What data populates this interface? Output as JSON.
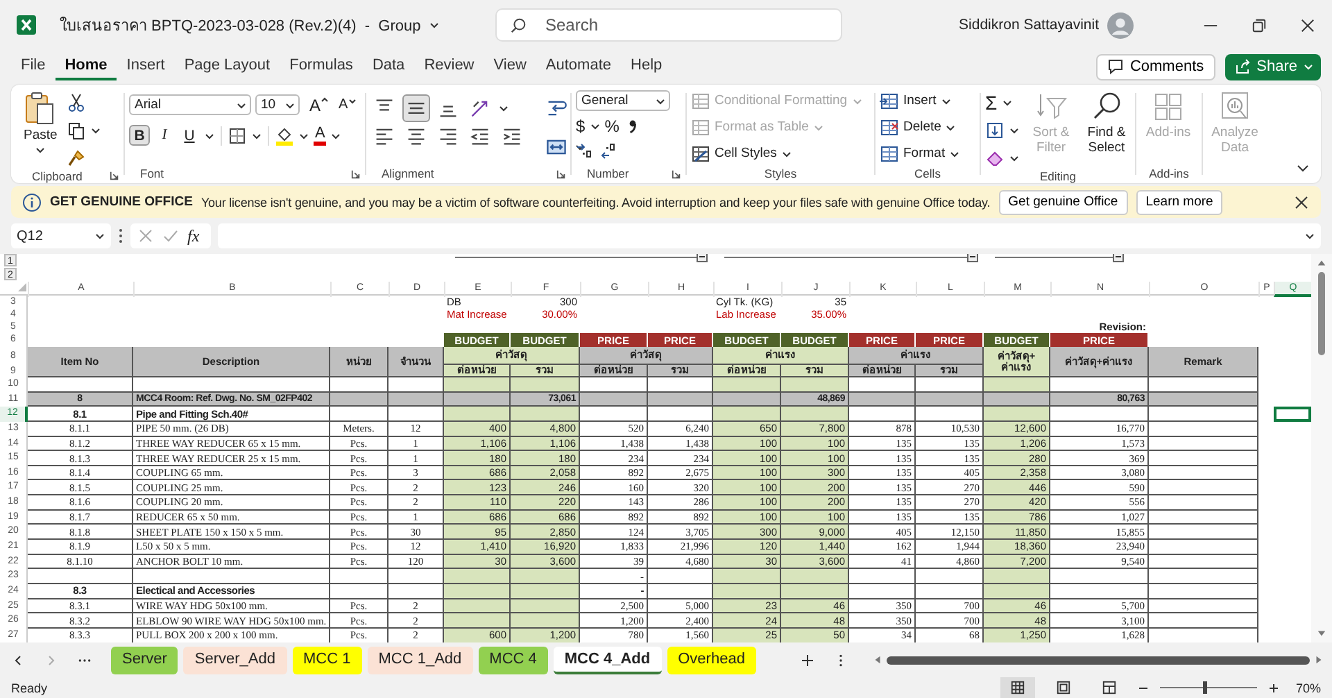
{
  "window": {
    "title": "ใบเสนอราคา BPTQ-2023-03-028 (Rev.2)(4)  -  Group",
    "user": "Siddikron Sattayavinit"
  },
  "search": {
    "placeholder": "Search"
  },
  "menu": [
    {
      "label": "File",
      "selected": false
    },
    {
      "label": "Home",
      "selected": true
    },
    {
      "label": "Insert",
      "selected": false
    },
    {
      "label": "Page Layout",
      "selected": false
    },
    {
      "label": "Formulas",
      "selected": false
    },
    {
      "label": "Data",
      "selected": false
    },
    {
      "label": "Review",
      "selected": false
    },
    {
      "label": "View",
      "selected": false
    },
    {
      "label": "Automate",
      "selected": false
    },
    {
      "label": "Help",
      "selected": false
    }
  ],
  "actions": {
    "comments": "Comments",
    "share": "Share"
  },
  "ribbon": {
    "clipboard": {
      "label": "Clipboard",
      "paste": "Paste"
    },
    "font": {
      "label": "Font",
      "name": "Arial",
      "size": "10",
      "grow": "A",
      "shrink": "A",
      "color_button": "A",
      "styles": [
        {
          "label": "B",
          "selected": true
        },
        {
          "label": "I",
          "selected": false
        },
        {
          "label": "U",
          "selected": false
        }
      ]
    },
    "alignment": {
      "label": "Alignment",
      "vertical": [
        {
          "selected": false
        },
        {
          "selected": true
        },
        {
          "selected": false
        }
      ]
    },
    "number": {
      "label": "Number",
      "format": "General",
      "currency": "$",
      "percent": "%"
    },
    "styles": {
      "label": "Styles",
      "items": [
        {
          "label": "Conditional Formatting",
          "disabled": true
        },
        {
          "label": "Format as Table",
          "disabled": true
        },
        {
          "label": "Cell Styles",
          "disabled": false
        }
      ]
    },
    "cells": {
      "label": "Cells",
      "items": [
        {
          "label": "Insert"
        },
        {
          "label": "Delete"
        },
        {
          "label": "Format"
        }
      ]
    },
    "editing": {
      "label": "Editing",
      "autosum": "Σ",
      "sort": {
        "label": "Sort & Filter",
        "disabled": true
      },
      "find": {
        "label": "Find & Select",
        "disabled": false
      }
    },
    "addins": {
      "label": "Add-ins",
      "button": {
        "label": "Add-ins",
        "disabled": true
      }
    },
    "analyze": {
      "label": "Analyze Data",
      "disabled": true
    }
  },
  "notice": {
    "title": "GET GENUINE OFFICE",
    "message": "Your license isn't genuine, and you may be a victim of software counterfeiting. Avoid interruption and keep your files safe with genuine Office today.",
    "buttons": [
      "Get genuine Office",
      "Learn more"
    ]
  },
  "formula_bar": {
    "cell": "Q12",
    "fx": "fx"
  },
  "outline_levels": [
    "1",
    "2"
  ],
  "columns": [
    {
      "letter": "A",
      "selected": false
    },
    {
      "letter": "B",
      "selected": false
    },
    {
      "letter": "C",
      "selected": false
    },
    {
      "letter": "D",
      "selected": false
    },
    {
      "letter": "E",
      "selected": false
    },
    {
      "letter": "F",
      "selected": false
    },
    {
      "letter": "G",
      "selected": false
    },
    {
      "letter": "H",
      "selected": false
    },
    {
      "letter": "I",
      "selected": false
    },
    {
      "letter": "J",
      "selected": false
    },
    {
      "letter": "K",
      "selected": false
    },
    {
      "letter": "L",
      "selected": false
    },
    {
      "letter": "M",
      "selected": false
    },
    {
      "letter": "N",
      "selected": false
    },
    {
      "letter": "O",
      "selected": false
    },
    {
      "letter": "P",
      "selected": false
    },
    {
      "letter": "Q",
      "selected": true
    }
  ],
  "top_rows": [
    {
      "num": "3",
      "kind": "info",
      "selected": false,
      "cells": {
        "E": "DB",
        "F": "300",
        "I": "Cyl Tk. (KG)",
        "J": "35"
      }
    },
    {
      "num": "4",
      "kind": "alert",
      "selected": false,
      "cells": {
        "E": "Mat Increase",
        "F": "30.00%",
        "I": "Lab Increase",
        "J": "35.00%"
      }
    },
    {
      "num": "5",
      "kind": "caption",
      "selected": false,
      "cells": {
        "N": "Revision:"
      }
    },
    {
      "num": "6",
      "kind": "band",
      "selected": false,
      "cells": {
        "E": {
          "text": "BUDGET",
          "color": "#4f6228"
        },
        "F": {
          "text": "BUDGET",
          "color": "#4f6228"
        },
        "G": {
          "text": "PRICE",
          "color": "#a3302c"
        },
        "H": {
          "text": "PRICE",
          "color": "#a3302c"
        },
        "I": {
          "text": "BUDGET",
          "color": "#4f6228"
        },
        "J": {
          "text": "BUDGET",
          "color": "#4f6228"
        },
        "K": {
          "text": "PRICE",
          "color": "#a3302c"
        },
        "L": {
          "text": "PRICE",
          "color": "#a3302c"
        },
        "M": {
          "text": "BUDGET",
          "color": "#4f6228"
        },
        "N": {
          "text": "PRICE",
          "color": "#a3302c"
        }
      }
    }
  ],
  "header": {
    "rows": [
      {
        "num": "8",
        "selected": false
      },
      {
        "num": "9",
        "selected": false
      }
    ],
    "cells": [
      {
        "text": "Item No",
        "color": "#bfbfbf",
        "kind": "tall"
      },
      {
        "text": "Description",
        "color": "#bfbfbf",
        "kind": "tall"
      },
      {
        "text": "หน่วย",
        "color": "#bfbfbf",
        "kind": "tall"
      },
      {
        "text": "จำนวน",
        "color": "#bfbfbf",
        "kind": "tall"
      },
      {
        "text": "ค่าวัสดุ",
        "color": "#d8e4bc",
        "kind": "wide"
      },
      {
        "text": "ค่าวัสดุ",
        "color": "#bfbfbf",
        "kind": "wide"
      },
      {
        "text": "ค่าแรง",
        "color": "#d8e4bc",
        "kind": "wide"
      },
      {
        "text": "ค่าแรง",
        "color": "#bfbfbf",
        "kind": "wide"
      },
      {
        "text": "ค่าวัสดุ+ ค่าแรง",
        "color": "#d8e4bc",
        "kind": "tall"
      },
      {
        "text": "ค่าวัสดุ+ค่าแรง",
        "color": "#bfbfbf",
        "kind": "tall"
      },
      {
        "text": "Remark",
        "color": "#bfbfbf",
        "kind": "tall"
      },
      {
        "text": "ต่อหน่วย",
        "color": "#d8e4bc",
        "kind": "sub"
      },
      {
        "text": "รวม",
        "color": "#d8e4bc",
        "kind": "sub"
      },
      {
        "text": "ต่อหน่วย",
        "color": "#bfbfbf",
        "kind": "sub"
      },
      {
        "text": "รวม",
        "color": "#bfbfbf",
        "kind": "sub"
      },
      {
        "text": "ต่อหน่วย",
        "color": "#d8e4bc",
        "kind": "sub"
      },
      {
        "text": "รวม",
        "color": "#d8e4bc",
        "kind": "sub"
      },
      {
        "text": "ต่อหน่วย",
        "color": "#bfbfbf",
        "kind": "sub"
      },
      {
        "text": "รวม",
        "color": "#bfbfbf",
        "kind": "sub"
      }
    ]
  },
  "rows": [
    {
      "num": "10",
      "kind": "blank",
      "selected": false
    },
    {
      "num": "11",
      "kind": "total",
      "selected": false,
      "cells": {
        "A": "8",
        "B": "MCC4 Room: Ref. Dwg. No. SM_02FP402",
        "F": "73,061",
        "J": "48,869",
        "N": "80,763"
      }
    },
    {
      "num": "12",
      "kind": "section",
      "selected": true,
      "cells": {
        "A": "8.1",
        "B": "Pipe and Fitting Sch.40#"
      }
    },
    {
      "num": "13",
      "kind": "item",
      "selected": false,
      "cells": {
        "A": "8.1.1",
        "B": "PIPE 50 mm. (26 DB)",
        "C": "Meters.",
        "D": "12",
        "E": "400",
        "F": "4,800",
        "G": "520",
        "H": "6,240",
        "I": "650",
        "J": "7,800",
        "K": "878",
        "L": "10,530",
        "M": "12,600",
        "N": "16,770"
      }
    },
    {
      "num": "14",
      "kind": "item",
      "selected": false,
      "cells": {
        "A": "8.1.2",
        "B": "THREE WAY REDUCER 65 x 15 mm.",
        "C": "Pcs.",
        "D": "1",
        "E": "1,106",
        "F": "1,106",
        "G": "1,438",
        "H": "1,438",
        "I": "100",
        "J": "100",
        "K": "135",
        "L": "135",
        "M": "1,206",
        "N": "1,573"
      }
    },
    {
      "num": "15",
      "kind": "item",
      "selected": false,
      "cells": {
        "A": "8.1.3",
        "B": "THREE WAY REDUCER 25 x 15 mm.",
        "C": "Pcs.",
        "D": "1",
        "E": "180",
        "F": "180",
        "G": "234",
        "H": "234",
        "I": "100",
        "J": "100",
        "K": "135",
        "L": "135",
        "M": "280",
        "N": "369"
      }
    },
    {
      "num": "16",
      "kind": "item",
      "selected": false,
      "cells": {
        "A": "8.1.4",
        "B": "COUPLING 65 mm.",
        "C": "Pcs.",
        "D": "3",
        "E": "686",
        "F": "2,058",
        "G": "892",
        "H": "2,675",
        "I": "100",
        "J": "300",
        "K": "135",
        "L": "405",
        "M": "2,358",
        "N": "3,080"
      }
    },
    {
      "num": "17",
      "kind": "item",
      "selected": false,
      "cells": {
        "A": "8.1.5",
        "B": "COUPLING 25 mm.",
        "C": "Pcs.",
        "D": "2",
        "E": "123",
        "F": "246",
        "G": "160",
        "H": "320",
        "I": "100",
        "J": "200",
        "K": "135",
        "L": "270",
        "M": "446",
        "N": "590"
      }
    },
    {
      "num": "18",
      "kind": "item",
      "selected": false,
      "cells": {
        "A": "8.1.6",
        "B": "COUPLING 20 mm.",
        "C": "Pcs.",
        "D": "2",
        "E": "110",
        "F": "220",
        "G": "143",
        "H": "286",
        "I": "100",
        "J": "200",
        "K": "135",
        "L": "270",
        "M": "420",
        "N": "556"
      }
    },
    {
      "num": "19",
      "kind": "item",
      "selected": false,
      "cells": {
        "A": "8.1.7",
        "B": "REDUCER 65 x 50 mm.",
        "C": "Pcs.",
        "D": "1",
        "E": "686",
        "F": "686",
        "G": "892",
        "H": "892",
        "I": "100",
        "J": "100",
        "K": "135",
        "L": "135",
        "M": "786",
        "N": "1,027"
      }
    },
    {
      "num": "20",
      "kind": "item",
      "selected": false,
      "cells": {
        "A": "8.1.8",
        "B": "SHEET PLATE 150 x 150 x 5 mm.",
        "C": "Pcs.",
        "D": "30",
        "E": "95",
        "F": "2,850",
        "G": "124",
        "H": "3,705",
        "I": "300",
        "J": "9,000",
        "K": "405",
        "L": "12,150",
        "M": "11,850",
        "N": "15,855"
      }
    },
    {
      "num": "21",
      "kind": "item",
      "selected": false,
      "cells": {
        "A": "8.1.9",
        "B": "L50 x 50 x 5 mm.",
        "C": "Pcs.",
        "D": "12",
        "E": "1,410",
        "F": "16,920",
        "G": "1,833",
        "H": "21,996",
        "I": "120",
        "J": "1,440",
        "K": "162",
        "L": "1,944",
        "M": "18,360",
        "N": "23,940"
      }
    },
    {
      "num": "22",
      "kind": "item",
      "selected": false,
      "cells": {
        "A": "8.1.10",
        "B": "ANCHOR BOLT 10 mm.",
        "C": "Pcs.",
        "D": "120",
        "E": "30",
        "F": "3,600",
        "G": "39",
        "H": "4,680",
        "I": "30",
        "J": "3,600",
        "K": "41",
        "L": "4,860",
        "M": "7,200",
        "N": "9,540"
      }
    },
    {
      "num": "23",
      "kind": "blank",
      "selected": false,
      "cells": {
        "G": "-"
      }
    },
    {
      "num": "24",
      "kind": "section",
      "selected": false,
      "cells": {
        "A": "8.3",
        "B": "Electical and Accessories",
        "G": "-"
      }
    },
    {
      "num": "25",
      "kind": "item",
      "selected": false,
      "cells": {
        "A": "8.3.1",
        "B": "WIRE WAY HDG 50x100 mm.",
        "C": "Pcs.",
        "D": "2",
        "G": "2,500",
        "H": "5,000",
        "I": "23",
        "J": "46",
        "K": "350",
        "L": "700",
        "M": "46",
        "N": "5,700"
      }
    },
    {
      "num": "26",
      "kind": "item",
      "selected": false,
      "cells": {
        "A": "8.3.2",
        "B": "ELBLOW 90 WIRE WAY HDG 50x100 mm.",
        "C": "Pcs.",
        "D": "2",
        "G": "1,200",
        "H": "2,400",
        "I": "24",
        "J": "48",
        "K": "350",
        "L": "700",
        "M": "48",
        "N": "3,100"
      }
    },
    {
      "num": "27",
      "kind": "item",
      "selected": false,
      "cells": {
        "A": "8.3.3",
        "B": "PULL BOX 200 x 200 x 100 mm.",
        "C": "Pcs.",
        "D": "2",
        "E": "600",
        "F": "1,200",
        "G": "780",
        "H": "1,560",
        "I": "25",
        "J": "50",
        "K": "34",
        "L": "68",
        "M": "1,250",
        "N": "1,628"
      }
    }
  ],
  "sheets": [
    {
      "label": "Server",
      "color": "#92d050",
      "selected": false
    },
    {
      "label": "Server_Add",
      "color": "#fbe2d5",
      "selected": false
    },
    {
      "label": "MCC 1",
      "color": "#ffff00",
      "selected": false
    },
    {
      "label": "MCC 1_Add",
      "color": "#fbe2d5",
      "selected": false
    },
    {
      "label": "MCC 4",
      "color": "#92d050",
      "selected": false
    },
    {
      "label": "MCC 4_Add",
      "color": "#3c7d3a",
      "selected": true
    },
    {
      "label": "Overhead",
      "color": "#ffff00",
      "selected": false
    }
  ],
  "status": {
    "text": "Ready",
    "zoom": {
      "label": "70%",
      "level": 0.45
    }
  }
}
